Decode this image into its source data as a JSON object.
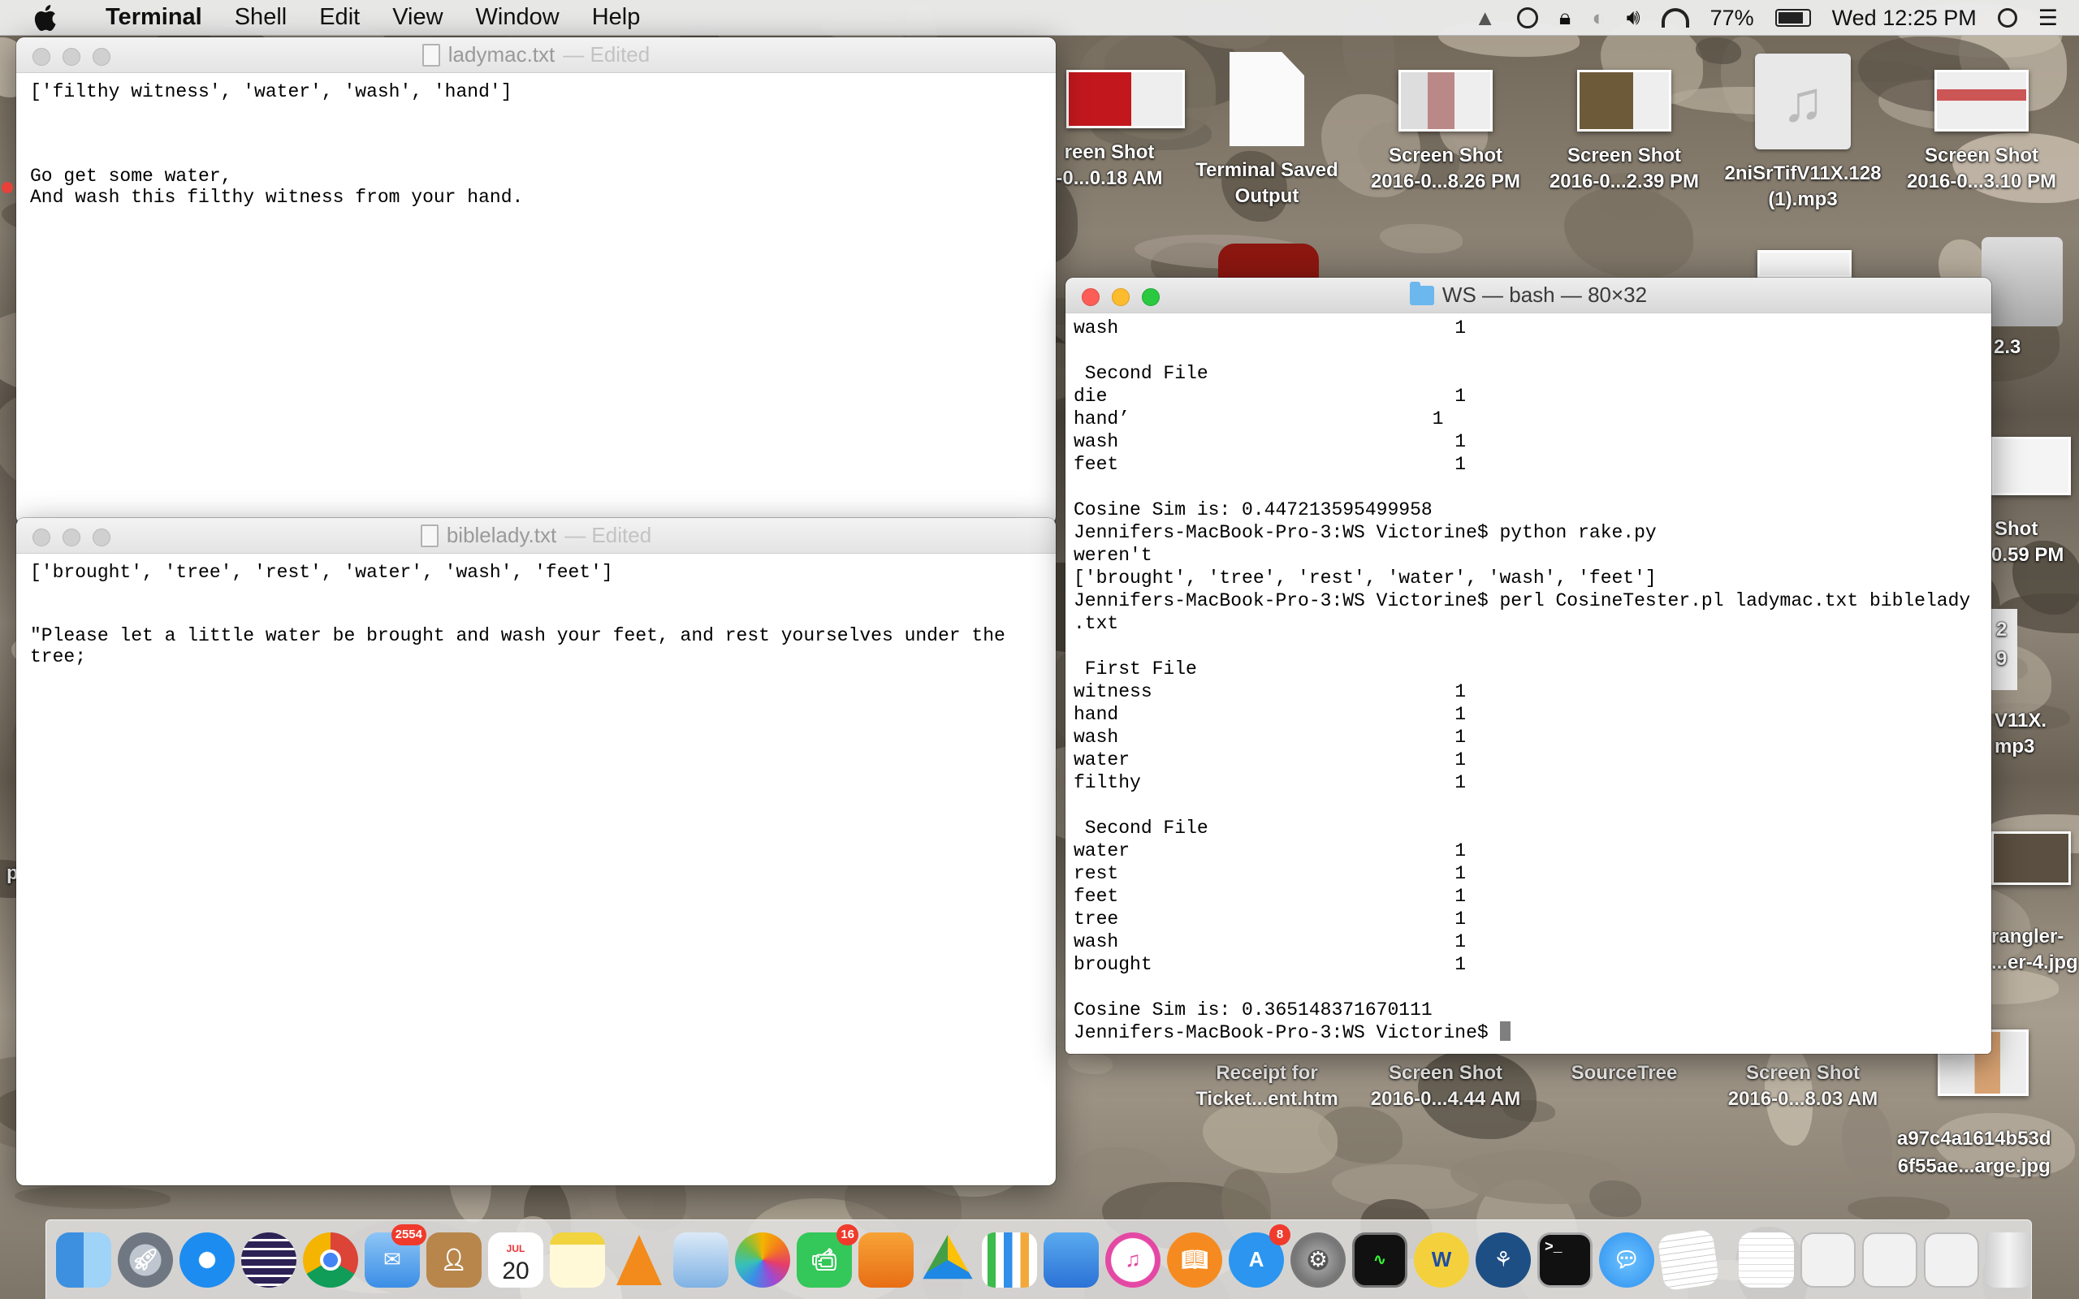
{
  "menubar": {
    "app_name": "Terminal",
    "items": [
      "Shell",
      "Edit",
      "View",
      "Window",
      "Help"
    ],
    "battery": "77%",
    "clock": "Wed 12:25 PM"
  },
  "desktop_icons": [
    {
      "line1": "reen Shot",
      "line2": "-0...0.18 AM"
    },
    {
      "line1": "Terminal Saved",
      "line2": "Output"
    },
    {
      "line1": "Screen Shot",
      "line2": "2016-0...8.26 PM"
    },
    {
      "line1": "Screen Shot",
      "line2": "2016-0...2.39 PM"
    },
    {
      "line1": "2niSrTifV11X.128",
      "line2": "(1).mp3"
    },
    {
      "line1": "Screen Shot",
      "line2": "2016-0...3.10 PM"
    },
    {
      "line1": "Receipt for",
      "line2": "Ticket...ent.htm"
    },
    {
      "line1": "Screen Shot",
      "line2": "2016-0...4.44 AM"
    },
    {
      "line1": "SourceTree",
      "line2": ""
    },
    {
      "line1": "Screen Shot",
      "line2": "2016-0...8.03 AM"
    },
    {
      "line1": "a97c4a1614b53d",
      "line2": "6f55ae...arge.jpg"
    }
  ],
  "partial_labels": {
    "v23": "2.3",
    "shot": "Shot",
    "shot_time": "0.59 PM",
    "v11x": "V11X.",
    "mp3": "mp3",
    "wrangler": "rangler-",
    "wrangler2": "...er-4.jpg",
    "n2": "2",
    "n9": "9",
    "p": "p"
  },
  "ladymac": {
    "title": "ladymac.txt",
    "edited": "— Edited",
    "lines": [
      "['filthy witness', 'water', 'wash', 'hand']",
      "",
      "",
      "",
      "Go get some water,",
      "And wash this filthy witness from your hand."
    ]
  },
  "biblelady": {
    "title": "biblelady.txt",
    "edited": "— Edited",
    "lines": [
      "['brought', 'tree', 'rest', 'water', 'wash', 'feet']",
      "",
      "",
      "\"Please let a little water be brought and wash your feet, and rest yourselves under the",
      "tree;"
    ]
  },
  "terminal": {
    "title": "WS — bash — 80×32",
    "lines": [
      "wash                              1",
      "",
      " Second File",
      "die                               1",
      "hand’                           1",
      "wash                              1",
      "feet                              1",
      "",
      "Cosine Sim is: 0.447213595499958",
      "Jennifers-MacBook-Pro-3:WS Victorine$ python rake.py",
      "weren't",
      "['brought', 'tree', 'rest', 'water', 'wash', 'feet']",
      "Jennifers-MacBook-Pro-3:WS Victorine$ perl CosineTester.pl ladymac.txt biblelady",
      ".txt",
      "",
      " First File",
      "witness                           1",
      "hand                              1",
      "wash                              1",
      "water                             1",
      "filthy                            1",
      "",
      " Second File",
      "water                             1",
      "rest                              1",
      "feet                              1",
      "tree                              1",
      "wash                              1",
      "brought                           1",
      "",
      "Cosine Sim is: 0.365148371670111"
    ],
    "prompt": "Jennifers-MacBook-Pro-3:WS Victorine$ "
  },
  "dock": {
    "mail_badge": "2554",
    "calendar_month": "JUL",
    "calendar_day": "20",
    "facetime_badge": "16",
    "appstore_badge": "8"
  }
}
